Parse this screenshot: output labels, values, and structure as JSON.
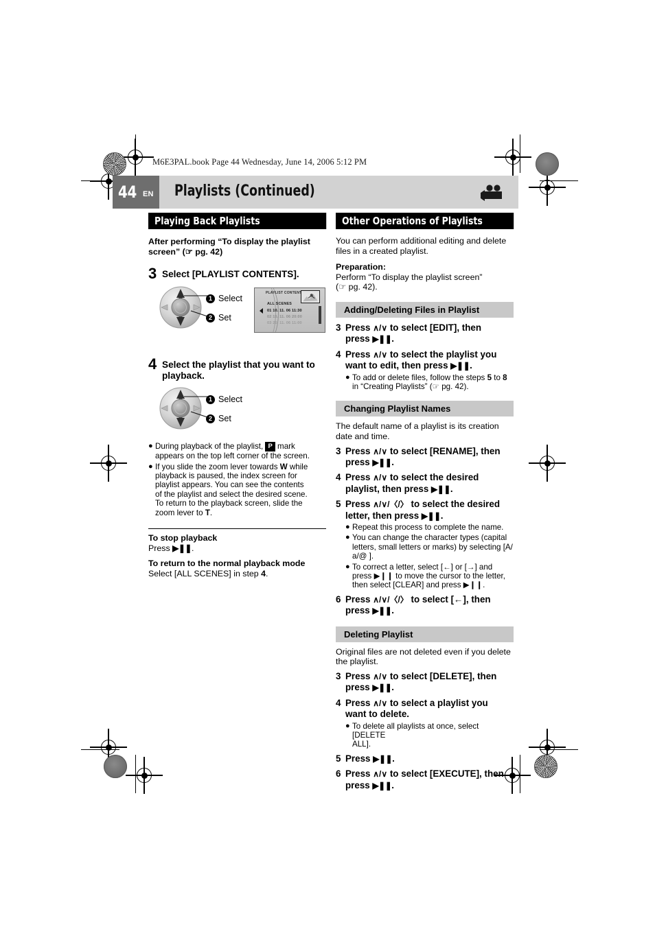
{
  "document": {
    "book_line": "M6E3PAL.book  Page 44  Wednesday, June 14, 2006  5:12 PM",
    "page_number": "44",
    "language_code": "EN",
    "title": "Playlists (Continued)",
    "header_icon": "video-camera-icon"
  },
  "left_column": {
    "section_title": "Playing Back Playlists",
    "intro_line1": "After performing “To display the playlist",
    "intro_line2": "screen” (☞ pg. 42)",
    "step3": {
      "number": "3",
      "text": "Select [PLAYLIST CONTENTS]."
    },
    "joystick_labels": {
      "one": "❶",
      "one_text": "Select",
      "two": "❷",
      "two_text": "Set"
    },
    "lcd": {
      "title": "PLAYLIST CONTENTS",
      "subtitle": "ALL SCENES",
      "rows": [
        "01 10. 11. 06   11:30",
        "02  15. 11. 06    20:00",
        "03  25. 11. 06    11:00"
      ]
    },
    "step4": {
      "number": "4",
      "line1": "Select the playlist that you want to",
      "line2": "playback."
    },
    "bullets": [
      "During playback of the playlist, [P] mark appears on the top left corner of the screen.",
      "If you slide the zoom lever towards W while playback is paused, the index screen for playlist appears. You can see the contents of the playlist and select the desired scene. To return to the playback screen, slide the zoom lever to T."
    ],
    "bullet1_part1": "During playback of the playlist, ",
    "bullet1_pmark": "P",
    "bullet1_part2": " mark",
    "bullet1_line2": "appears on the top left corner of the screen.",
    "bullet2_line1_a": "If you slide the zoom lever towards ",
    "bullet2_w": "W",
    "bullet2_line1_b": " while",
    "bullet2_line2": "playback is paused, the index screen for",
    "bullet2_line3": "playlist appears. You can see the contents",
    "bullet2_line4": "of the playlist and select the desired scene.",
    "bullet2_line5": "To return to the playback screen, slide the",
    "bullet2_line6_a": "zoom lever to ",
    "bullet2_t": "T",
    "bullet2_line6_b": ".",
    "stop_heading": "To stop playback",
    "stop_text_pre": "Press ",
    "stop_text_post": ".",
    "return_heading": "To return to the normal playback mode",
    "return_text_pre": "Select [ALL SCENES] in step ",
    "return_text_num": "4",
    "return_text_post": "."
  },
  "right_column": {
    "section_title": "Other Operations of Playlists",
    "intro_line1": "You can perform additional editing and delete",
    "intro_line2": "files in a created playlist.",
    "preparation_heading": "Preparation:",
    "preparation_line1": "Perform “To display the playlist screen”",
    "preparation_line2": "(☞ pg. 42).",
    "sections": [
      {
        "heading": "Adding/Deleting Files in Playlist",
        "steps": [
          {
            "number": "3",
            "line1_a": "Press ",
            "nav": "∧/∨",
            "line1_b": " to select [EDIT], then",
            "line2_a": "press ",
            "line2_b": "."
          },
          {
            "number": "4",
            "line1_a": "Press ",
            "nav": "∧/∨",
            "line1_b": " to select the playlist you",
            "line2_a": "want to edit, then press ",
            "line2_b": "."
          }
        ],
        "bullets": [
          {
            "line1_a": "To add or delete files, follow the steps ",
            "bold1": "5",
            "line1_mid": " to ",
            "bold2": "8",
            "line2": "in “Creating Playlists” (☞ pg. 42)."
          }
        ]
      },
      {
        "heading": "Changing Playlist Names",
        "body_line1": "The default name of a playlist is its creation",
        "body_line2": "date and time.",
        "steps": [
          {
            "number": "3",
            "line1_a": "Press ",
            "nav": "∧/∨",
            "line1_b": " to select [RENAME], then",
            "line2_a": "press ",
            "line2_b": "."
          },
          {
            "number": "4",
            "line1_a": "Press ",
            "nav": "∧/∨",
            "line1_b": " to select the desired",
            "line2_a": "playlist, then press ",
            "line2_b": "."
          },
          {
            "number": "5",
            "line1_a": "Press ",
            "nav": "∧/∨/〈/〉",
            "line1_b": " to select the desired",
            "line2_a": "letter, then press ",
            "line2_b": "."
          }
        ],
        "bullets": [
          {
            "text": "Repeat this process to complete the name."
          },
          {
            "text": "You can change the character types (capital letters, small letters or marks) by selecting [A/ a/@ ]."
          },
          {
            "text": "To correct a letter, select [←] or [→] and press ▶❙❙ to move the cursor to the letter, then select [CLEAR] and press ▶❙❙."
          }
        ],
        "final_step": {
          "number": "6",
          "line1_a": "Press ",
          "nav": "∧/∨/〈/〉",
          "line1_b": " to select [←], then",
          "line2_a": "press ",
          "line2_b": "."
        }
      },
      {
        "heading": "Deleting Playlist",
        "body_line1": "Original files are not deleted even if you delete",
        "body_line2": "the playlist.",
        "steps": [
          {
            "number": "3",
            "line1_a": "Press ",
            "nav": "∧/∨",
            "line1_b": " to select [DELETE], then",
            "line2_a": "press ",
            "line2_b": "."
          },
          {
            "number": "4",
            "line1_a": "Press ",
            "nav": "∧/∨",
            "line1_b": " to select a playlist you",
            "line2_a": "want to delete.",
            "line2_b": ""
          }
        ],
        "bullets": [
          {
            "line1": "To delete all playlists at once, select [DELETE",
            "line2": "ALL]."
          }
        ],
        "step5": {
          "number": "5",
          "line1_a": "Press ",
          "line1_b": "."
        },
        "step6": {
          "number": "6",
          "line1_a": "Press ",
          "nav": "∧/∨",
          "line1_b": " to select [EXECUTE], then",
          "line2_a": "press ",
          "line2_b": "."
        }
      }
    ]
  },
  "colors": {
    "header_band": "#d2d2d2",
    "page_box": "#6e6e6e",
    "bar_black": "#000000",
    "bar_gray": "#c8c8c8"
  }
}
